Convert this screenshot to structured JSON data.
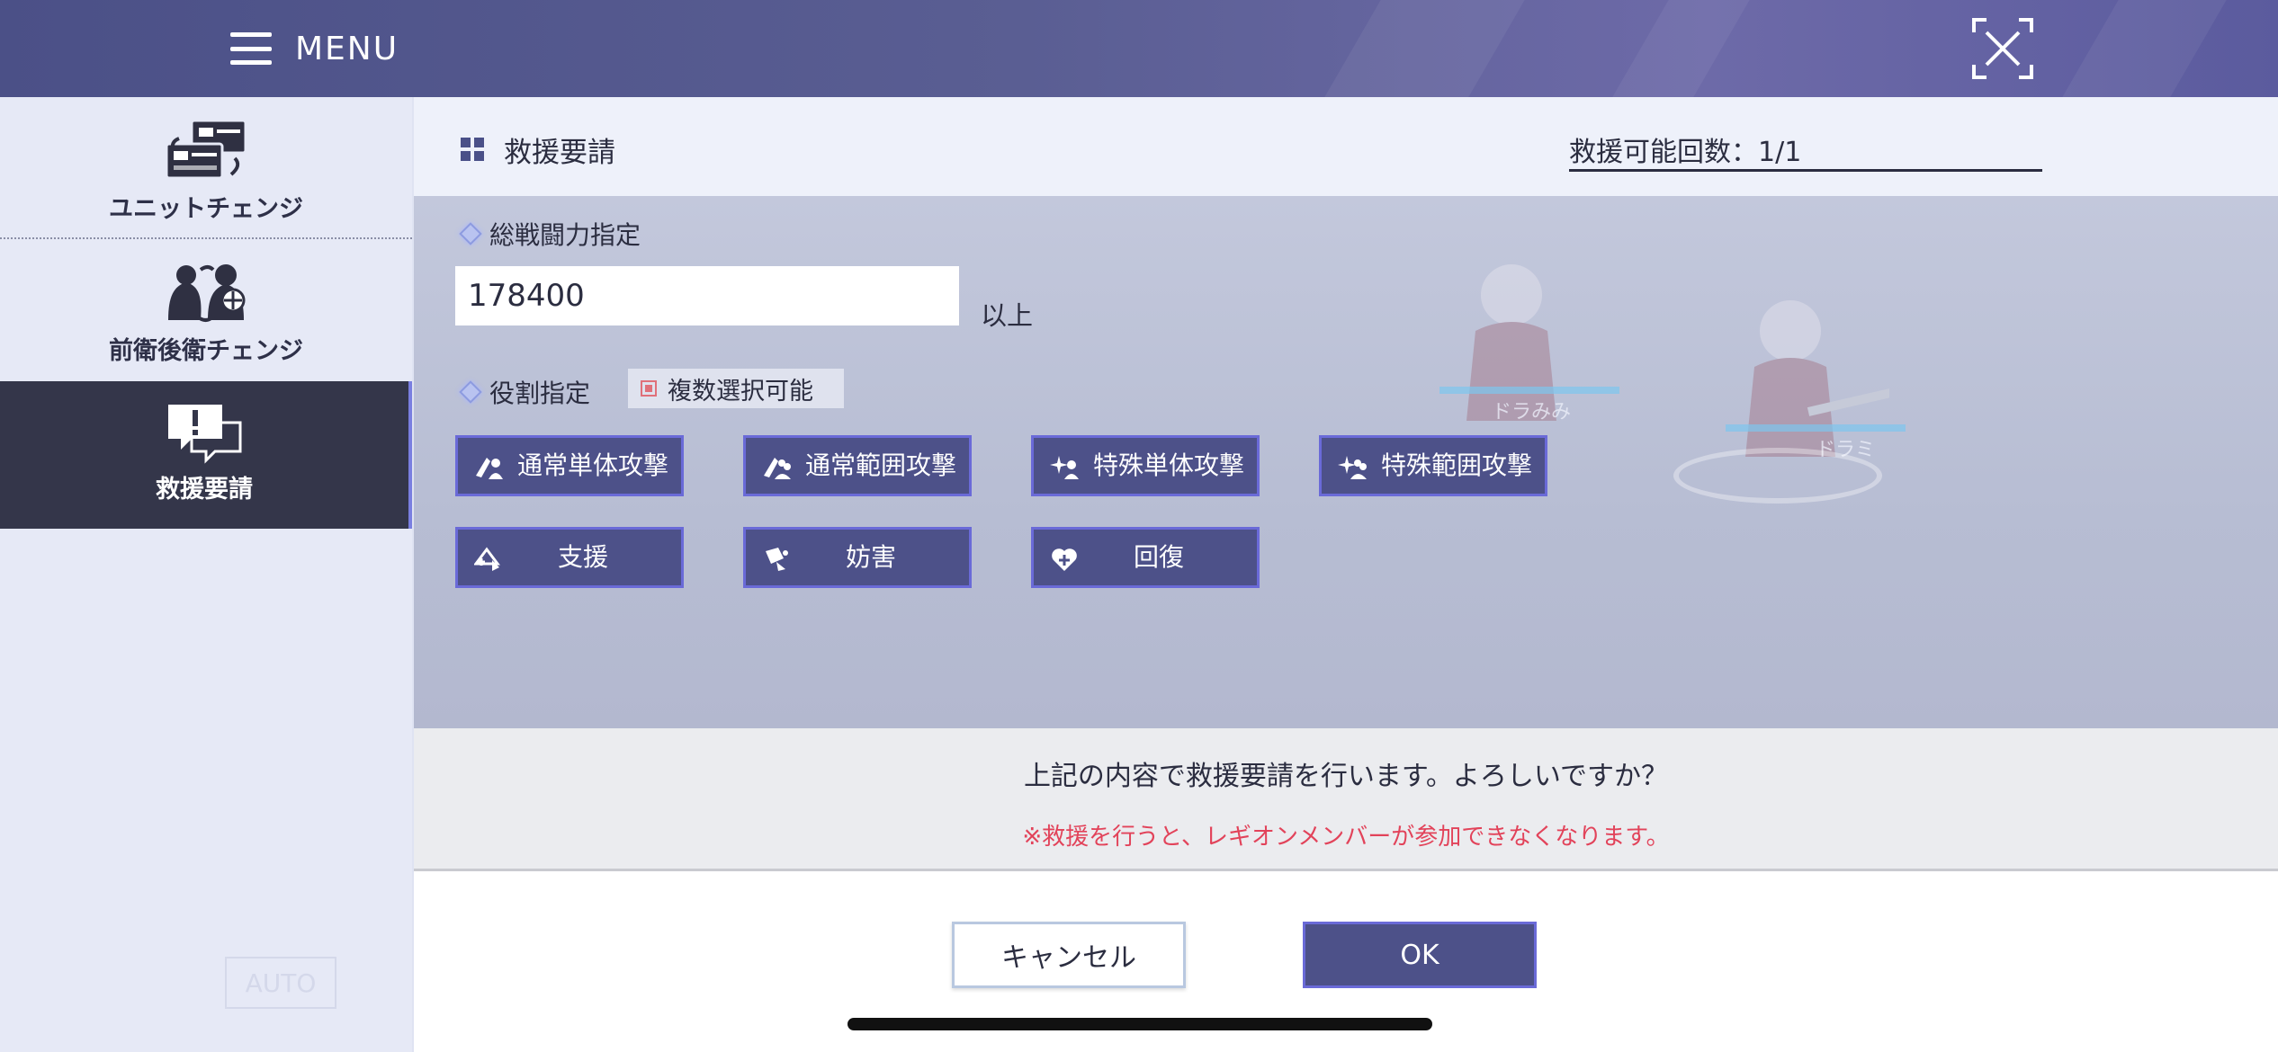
{
  "header": {
    "menu_label": "MENU"
  },
  "sidebar": {
    "items": [
      {
        "label": "ユニットチェンジ",
        "icon": "unit-change-icon",
        "active": false
      },
      {
        "label": "前衛後衛チェンジ",
        "icon": "vanguard-rearguard-change-icon",
        "active": false
      },
      {
        "label": "救援要請",
        "icon": "rescue-request-icon",
        "active": true
      }
    ],
    "auto_label": "AUTO"
  },
  "panel": {
    "title": "救援要請",
    "rescue_count": "救援可能回数：1/1",
    "power_label": "総戦闘力指定",
    "power_value": "178400",
    "power_suffix": "以上",
    "role_label": "役割指定",
    "multi_select": "複数選択可能",
    "roles": [
      {
        "label": "通常単体攻撃",
        "icon": "normal-single-attack-icon"
      },
      {
        "label": "通常範囲攻撃",
        "icon": "normal-range-attack-icon"
      },
      {
        "label": "特殊単体攻撃",
        "icon": "special-single-attack-icon"
      },
      {
        "label": "特殊範囲攻撃",
        "icon": "special-range-attack-icon"
      },
      {
        "label": "支援",
        "icon": "support-icon"
      },
      {
        "label": "妨害",
        "icon": "obstruct-icon"
      },
      {
        "label": "回復",
        "icon": "heal-icon"
      }
    ],
    "background_names": [
      "ドラみみ",
      "ドラミ"
    ]
  },
  "confirm": {
    "question": "上記の内容で救援要請を行います。よろしいですか？",
    "warning": "※救援を行うと、レギオンメンバーが参加できなくなります。"
  },
  "buttons": {
    "cancel": "キャンセル",
    "ok": "OK"
  },
  "colors": {
    "header": "#4b5087",
    "button": "#4d5189",
    "button_border": "#6a6ad8",
    "warning": "#e2435a",
    "sidebar_active": "#34364a"
  }
}
